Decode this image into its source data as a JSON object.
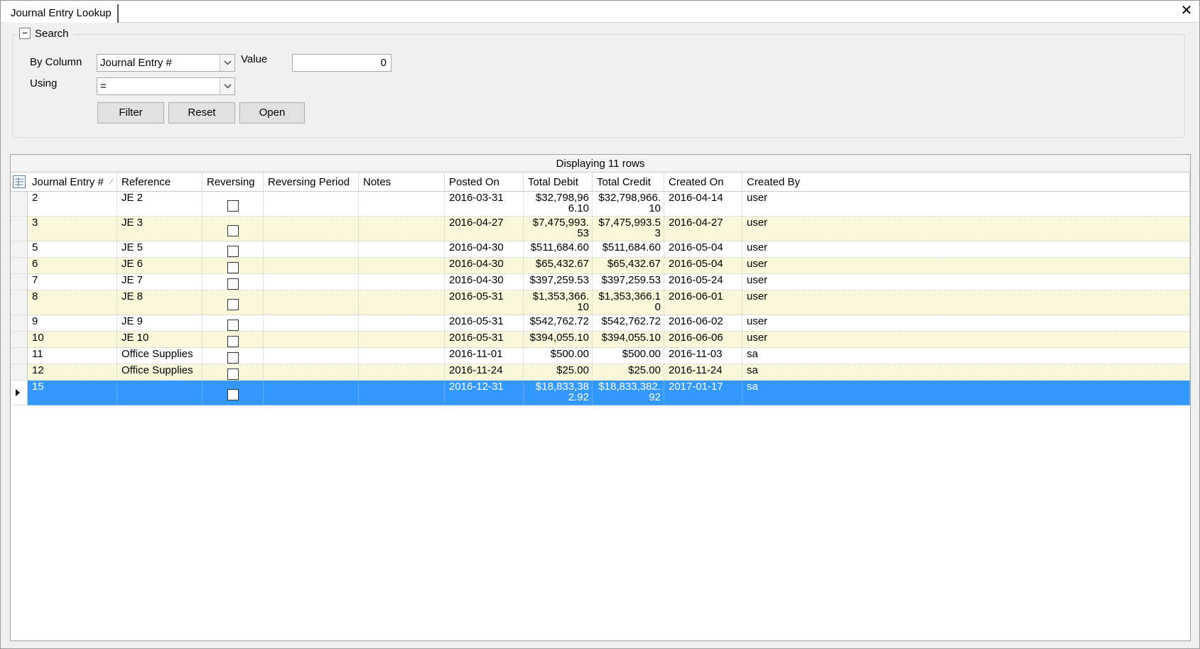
{
  "window": {
    "tab_title": "Journal Entry Lookup",
    "close_label": "✕"
  },
  "search": {
    "group_title": "Search",
    "collapse_glyph": "−",
    "by_column_label": "By Column",
    "by_column_value": "Journal Entry #",
    "value_label": "Value",
    "value": "0",
    "using_label": "Using",
    "using_value": "=",
    "filter_label": "Filter",
    "reset_label": "Reset",
    "open_label": "Open"
  },
  "grid": {
    "caption": "Displaying 11 rows",
    "columns": [
      "Journal Entry #",
      "Reference",
      "Reversing",
      "Reversing Period",
      "Notes",
      "Posted On",
      "Total Debit",
      "Total Credit",
      "Created On",
      "Created By"
    ],
    "sort_indicator": "⁄",
    "rows": [
      {
        "je": "2",
        "ref": "JE 2",
        "reversing": false,
        "period": "",
        "notes": "",
        "posted": "2016-03-31",
        "debit": "$32,798,966.10",
        "credit": "$32,798,966.10",
        "created": "2016-04-14",
        "by": "user"
      },
      {
        "je": "3",
        "ref": "JE 3",
        "reversing": false,
        "period": "",
        "notes": "",
        "posted": "2016-04-27",
        "debit": "$7,475,993.53",
        "credit": "$7,475,993.53",
        "created": "2016-04-27",
        "by": "user"
      },
      {
        "je": "5",
        "ref": "JE 5",
        "reversing": false,
        "period": "",
        "notes": "",
        "posted": "2016-04-30",
        "debit": "$511,684.60",
        "credit": "$511,684.60",
        "created": "2016-05-04",
        "by": "user"
      },
      {
        "je": "6",
        "ref": "JE 6",
        "reversing": false,
        "period": "",
        "notes": "",
        "posted": "2016-04-30",
        "debit": "$65,432.67",
        "credit": "$65,432.67",
        "created": "2016-05-04",
        "by": "user"
      },
      {
        "je": "7",
        "ref": "JE 7",
        "reversing": false,
        "period": "",
        "notes": "",
        "posted": "2016-04-30",
        "debit": "$397,259.53",
        "credit": "$397,259.53",
        "created": "2016-05-24",
        "by": "user"
      },
      {
        "je": "8",
        "ref": "JE 8",
        "reversing": false,
        "period": "",
        "notes": "",
        "posted": "2016-05-31",
        "debit": "$1,353,366.10",
        "credit": "$1,353,366.10",
        "created": "2016-06-01",
        "by": "user"
      },
      {
        "je": "9",
        "ref": "JE 9",
        "reversing": false,
        "period": "",
        "notes": "",
        "posted": "2016-05-31",
        "debit": "$542,762.72",
        "credit": "$542,762.72",
        "created": "2016-06-02",
        "by": "user"
      },
      {
        "je": "10",
        "ref": "JE 10",
        "reversing": false,
        "period": "",
        "notes": "",
        "posted": "2016-05-31",
        "debit": "$394,055.10",
        "credit": "$394,055.10",
        "created": "2016-06-06",
        "by": "user"
      },
      {
        "je": "11",
        "ref": "Office Supplies",
        "reversing": false,
        "period": "",
        "notes": "",
        "posted": "2016-11-01",
        "debit": "$500.00",
        "credit": "$500.00",
        "created": "2016-11-03",
        "by": "sa"
      },
      {
        "je": "12",
        "ref": "Office Supplies",
        "reversing": false,
        "period": "",
        "notes": "",
        "posted": "2016-11-24",
        "debit": "$25.00",
        "credit": "$25.00",
        "created": "2016-11-24",
        "by": "sa"
      },
      {
        "je": "15",
        "ref": "",
        "reversing": false,
        "period": "",
        "notes": "",
        "posted": "2016-12-31",
        "debit": "$18,833,382.92",
        "credit": "$18,833,382.92",
        "created": "2017-01-17",
        "by": "sa",
        "selected": true
      }
    ]
  },
  "colors": {
    "selection": "#3399ff",
    "alt_row": "#f9f8db"
  }
}
